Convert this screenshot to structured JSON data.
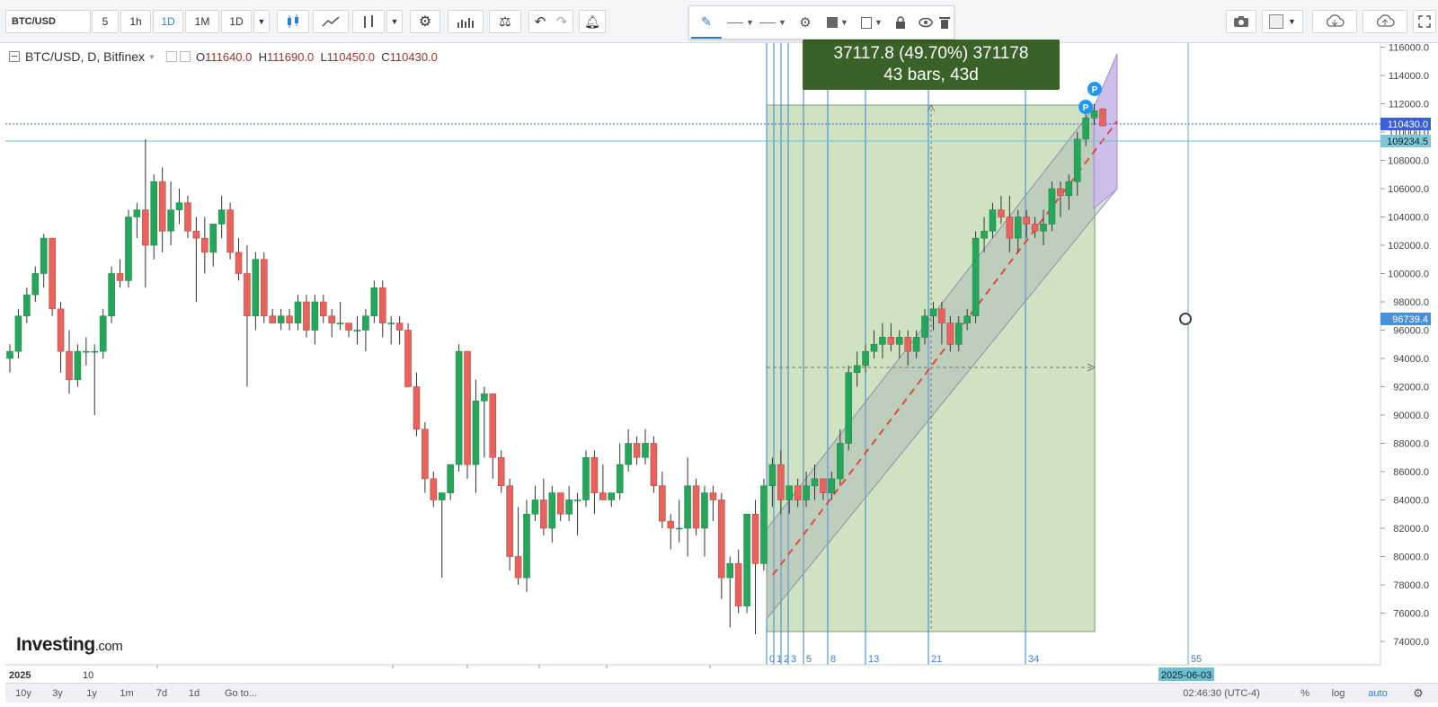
{
  "toolbar": {
    "symbol": "BTC/USD",
    "intervals": [
      "5",
      "1h",
      "1D",
      "1M",
      "1D"
    ],
    "active_interval": "1D"
  },
  "legend": {
    "title": "BTC/USD, D, Bitfinex",
    "open_label": "O",
    "open": "111640.0",
    "high_label": "H",
    "high": "111690.0",
    "low_label": "L",
    "low": "110450.0",
    "close_label": "C",
    "close": "110430.0"
  },
  "measure": {
    "line1": "37117.8 (49.70%) 371178",
    "line2": "43 bars, 43d"
  },
  "price_tags": {
    "last_price": "110430.0",
    "line_price": "109234.5",
    "cursor_price": "96739.4"
  },
  "fib_labels": [
    "0",
    "1",
    "2",
    "3",
    "5",
    "8",
    "13",
    "21",
    "34",
    "55"
  ],
  "date_axis": {
    "year": "2025",
    "month": "10",
    "cursor_date": "2025-06-03"
  },
  "bottom_bar": {
    "ranges": [
      "10y",
      "3y",
      "1y",
      "1m",
      "7d",
      "1d"
    ],
    "goto": "Go to...",
    "time": "02:46:30 (UTC-4)",
    "percent": "%",
    "log": "log",
    "auto": "auto"
  },
  "watermark": {
    "brand": "Investing",
    "domain": ".com"
  },
  "colors": {
    "up": "#26a65b",
    "down": "#e8635e",
    "channel": "#7f8c8d",
    "measure_fill": "#cfe3c2",
    "fib_line": "#3a7fd6",
    "accent": "#2f7fd1"
  },
  "chart_data": {
    "type": "candlestick",
    "ylim": [
      73000,
      116500
    ],
    "yticks": [
      74000,
      76000,
      78000,
      80000,
      82000,
      84000,
      86000,
      88000,
      90000,
      92000,
      94000,
      96000,
      98000,
      100000,
      102000,
      104000,
      106000,
      108000,
      110000,
      112000,
      114000,
      116000
    ],
    "candles": [
      [
        94000,
        95000,
        93000,
        94500
      ],
      [
        94500,
        97500,
        94000,
        97000
      ],
      [
        97000,
        99000,
        96500,
        98500
      ],
      [
        98500,
        100500,
        98000,
        100000
      ],
      [
        100000,
        102800,
        99000,
        102500
      ],
      [
        102500,
        102500,
        97000,
        97500
      ],
      [
        97500,
        98000,
        93000,
        94500
      ],
      [
        94500,
        96000,
        91500,
        92500
      ],
      [
        92500,
        95000,
        92000,
        94500
      ],
      [
        94500,
        95500,
        93500,
        94500
      ],
      [
        94500,
        95000,
        90000,
        94500
      ],
      [
        94500,
        97500,
        94000,
        97000
      ],
      [
        97000,
        100500,
        96500,
        100000
      ],
      [
        100000,
        101000,
        99000,
        99500
      ],
      [
        99500,
        104500,
        99000,
        104000
      ],
      [
        104000,
        105000,
        102500,
        104500
      ],
      [
        104500,
        109500,
        99000,
        102000
      ],
      [
        102000,
        107000,
        101000,
        106500
      ],
      [
        106500,
        107500,
        101500,
        103000
      ],
      [
        103000,
        106500,
        102000,
        104500
      ],
      [
        104500,
        106000,
        103500,
        105000
      ],
      [
        105000,
        105500,
        102500,
        103000
      ],
      [
        103000,
        104000,
        98000,
        102500
      ],
      [
        102500,
        104000,
        100000,
        101500
      ],
      [
        101500,
        103500,
        100500,
        103500
      ],
      [
        103500,
        105500,
        102500,
        104500
      ],
      [
        104500,
        105000,
        101000,
        101500
      ],
      [
        101500,
        102500,
        99500,
        100000
      ],
      [
        100000,
        102000,
        92000,
        97000
      ],
      [
        97000,
        101500,
        96000,
        101000
      ],
      [
        101000,
        101500,
        96500,
        97000
      ],
      [
        97000,
        97500,
        96500,
        96500
      ],
      [
        96500,
        97500,
        96000,
        97000
      ],
      [
        97000,
        97500,
        96000,
        96500
      ],
      [
        96500,
        98500,
        96000,
        98000
      ],
      [
        98000,
        98500,
        95500,
        96000
      ],
      [
        96000,
        98500,
        95000,
        98000
      ],
      [
        98000,
        98500,
        96500,
        97000
      ],
      [
        97000,
        97500,
        95500,
        96500
      ],
      [
        96500,
        98000,
        96000,
        96500
      ],
      [
        96500,
        96500,
        95500,
        96000
      ],
      [
        96000,
        97000,
        95000,
        96000
      ],
      [
        96000,
        97500,
        94500,
        97000
      ],
      [
        97000,
        99500,
        96500,
        99000
      ],
      [
        99000,
        99500,
        95500,
        96500
      ],
      [
        96500,
        97000,
        95000,
        96500
      ],
      [
        96500,
        97000,
        95000,
        96000
      ],
      [
        96000,
        96500,
        92000,
        92000
      ],
      [
        92000,
        93000,
        88500,
        89000
      ],
      [
        89000,
        89500,
        84500,
        85500
      ],
      [
        85500,
        86000,
        83500,
        84000
      ],
      [
        84000,
        84500,
        78500,
        84500
      ],
      [
        84500,
        86500,
        84000,
        86500
      ],
      [
        86500,
        95000,
        86000,
        94500
      ],
      [
        94500,
        94500,
        85500,
        86500
      ],
      [
        86500,
        92500,
        84500,
        91000
      ],
      [
        91000,
        92000,
        87000,
        91500
      ],
      [
        91500,
        91500,
        85500,
        87000
      ],
      [
        87000,
        87500,
        84500,
        85000
      ],
      [
        85000,
        85500,
        79000,
        80000
      ],
      [
        80000,
        83500,
        78000,
        78500
      ],
      [
        78500,
        84000,
        77500,
        83000
      ],
      [
        83000,
        85000,
        82500,
        84000
      ],
      [
        84000,
        85500,
        81500,
        82000
      ],
      [
        82000,
        85000,
        81000,
        84500
      ],
      [
        84500,
        84500,
        82500,
        83000
      ],
      [
        83000,
        85000,
        82500,
        84000
      ],
      [
        84000,
        84500,
        81500,
        84000
      ],
      [
        84000,
        87500,
        83500,
        87000
      ],
      [
        87000,
        87500,
        83000,
        84500
      ],
      [
        84500,
        86500,
        84000,
        84000
      ],
      [
        84000,
        84500,
        83500,
        84500
      ],
      [
        84500,
        88000,
        84000,
        86500
      ],
      [
        86500,
        89000,
        86000,
        88000
      ],
      [
        88000,
        88500,
        86500,
        87000
      ],
      [
        87000,
        89000,
        86500,
        88000
      ],
      [
        88000,
        88500,
        84500,
        85000
      ],
      [
        85000,
        86000,
        82000,
        82500
      ],
      [
        82500,
        83000,
        80500,
        82000
      ],
      [
        82000,
        84000,
        81000,
        82000
      ],
      [
        82000,
        87000,
        80000,
        85000
      ],
      [
        85000,
        85500,
        81500,
        82000
      ],
      [
        82000,
        85000,
        80000,
        84500
      ],
      [
        84500,
        85000,
        82500,
        84000
      ],
      [
        84000,
        84500,
        77000,
        78500
      ],
      [
        78500,
        80000,
        75000,
        79500
      ],
      [
        79500,
        80500,
        76000,
        76500
      ],
      [
        76500,
        83000,
        76000,
        83000
      ],
      [
        83000,
        84000,
        74500,
        79500
      ],
      [
        79500,
        85500,
        79000,
        85000
      ],
      [
        85000,
        87000,
        83500,
        86500
      ],
      [
        86500,
        87500,
        83000,
        84000
      ],
      [
        84000,
        85000,
        83000,
        85000
      ],
      [
        85000,
        85500,
        83500,
        84000
      ],
      [
        84000,
        86000,
        83500,
        85000
      ],
      [
        85000,
        86500,
        84000,
        85500
      ],
      [
        85500,
        85500,
        84000,
        84500
      ],
      [
        84500,
        86000,
        84000,
        85500
      ],
      [
        85500,
        89000,
        85000,
        88000
      ],
      [
        88000,
        93500,
        87500,
        93000
      ],
      [
        93000,
        94500,
        92000,
        93500
      ],
      [
        93500,
        95000,
        93000,
        94500
      ],
      [
        94500,
        96000,
        94000,
        95000
      ],
      [
        95000,
        96500,
        94000,
        95500
      ],
      [
        95500,
        96500,
        94500,
        95000
      ],
      [
        95000,
        96000,
        94000,
        95500
      ],
      [
        95500,
        96000,
        93500,
        94500
      ],
      [
        94500,
        96000,
        94000,
        95500
      ],
      [
        95500,
        97500,
        95000,
        97000
      ],
      [
        97000,
        98000,
        96000,
        97500
      ],
      [
        97500,
        98000,
        95000,
        96500
      ],
      [
        96500,
        97000,
        94500,
        95000
      ],
      [
        95000,
        97000,
        94500,
        96500
      ],
      [
        96500,
        97500,
        96000,
        97000
      ],
      [
        97000,
        103000,
        96500,
        102500
      ],
      [
        102500,
        104000,
        101500,
        103000
      ],
      [
        103000,
        105000,
        102500,
        104500
      ],
      [
        104500,
        105500,
        103500,
        104000
      ],
      [
        104000,
        105500,
        101500,
        102500
      ],
      [
        102500,
        104500,
        101500,
        104000
      ],
      [
        104000,
        104500,
        102500,
        103500
      ],
      [
        103500,
        104000,
        102500,
        103000
      ],
      [
        103000,
        104500,
        102000,
        103500
      ],
      [
        103500,
        106500,
        103000,
        106000
      ],
      [
        106000,
        106500,
        104000,
        105500
      ],
      [
        105500,
        107000,
        104500,
        106500
      ],
      [
        106500,
        110000,
        105500,
        109500
      ],
      [
        109500,
        111500,
        109000,
        111000
      ],
      [
        111000,
        112000,
        110500,
        111500
      ],
      [
        111640,
        111690,
        110450,
        110430
      ]
    ]
  }
}
